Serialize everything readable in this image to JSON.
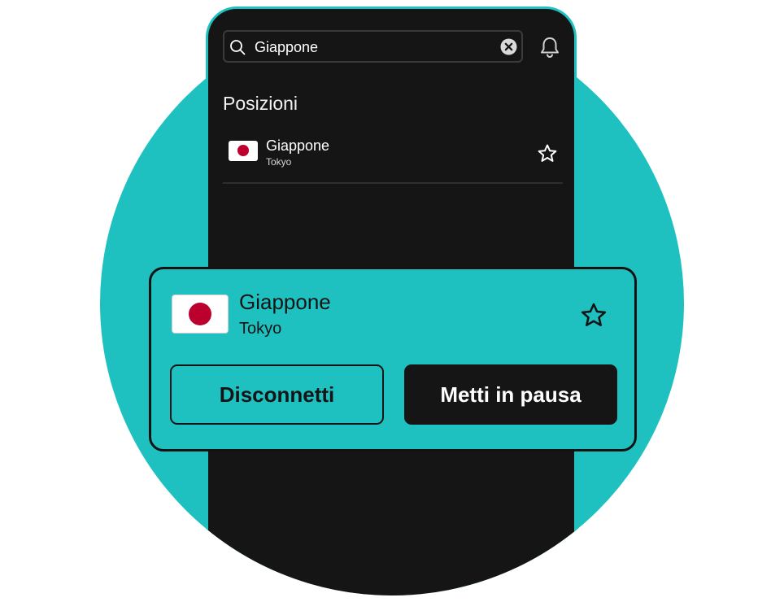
{
  "search": {
    "value": "Giappone",
    "icon": "search-icon",
    "clear_icon": "clear-icon"
  },
  "header": {
    "bell_icon": "bell-icon"
  },
  "locations": {
    "title": "Posizioni",
    "items": [
      {
        "name": "Giappone",
        "city": "Tokyo",
        "flag": "japan-flag",
        "favorite_icon": "star-icon"
      }
    ]
  },
  "connection_card": {
    "name": "Giappone",
    "city": "Tokyo",
    "flag": "japan-flag",
    "favorite_icon": "star-icon",
    "disconnect_label": "Disconnetti",
    "pause_label": "Metti in pausa"
  },
  "colors": {
    "accent": "#1fc0c0",
    "phone_bg": "#151515",
    "flag_red": "#bc002d",
    "text_dark": "#151515",
    "text_light": "#ffffff"
  }
}
